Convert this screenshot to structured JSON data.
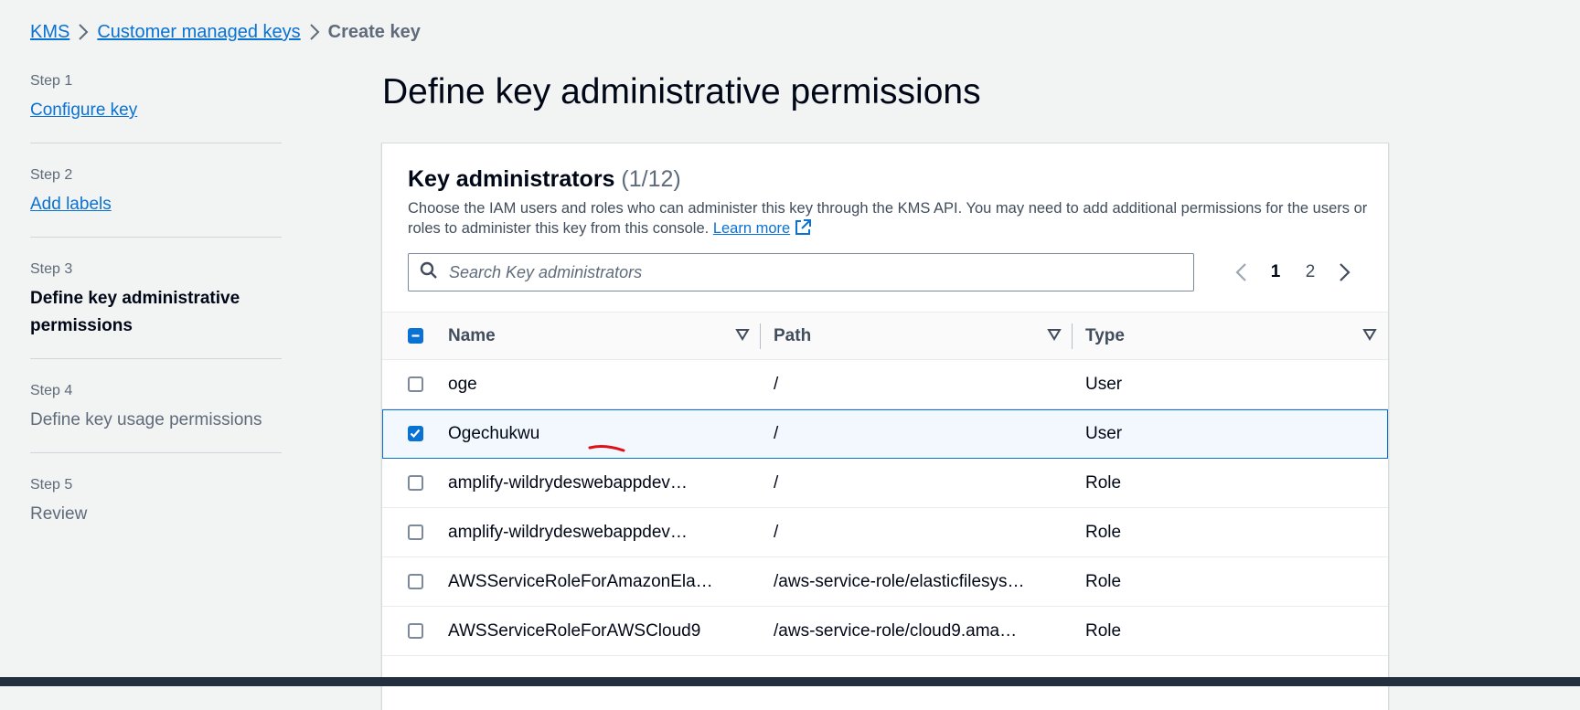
{
  "breadcrumb": {
    "items": [
      "KMS",
      "Customer managed keys"
    ],
    "current": "Create key"
  },
  "steps": [
    {
      "num": "Step 1",
      "title": "Configure key",
      "state": "link"
    },
    {
      "num": "Step 2",
      "title": "Add labels",
      "state": "link"
    },
    {
      "num": "Step 3",
      "title": "Define key administrative permissions",
      "state": "active"
    },
    {
      "num": "Step 4",
      "title": "Define key usage permissions",
      "state": "disabled"
    },
    {
      "num": "Step 5",
      "title": "Review",
      "state": "disabled"
    }
  ],
  "page": {
    "title": "Define key administrative permissions"
  },
  "panel": {
    "heading": "Key administrators",
    "count": "(1/12)",
    "description": "Choose the IAM users and roles who can administer this key through the KMS API. You may need to add additional permissions for the users or roles to administer this key from this console.",
    "learn_more": "Learn more"
  },
  "search": {
    "placeholder": "Search Key administrators",
    "value": ""
  },
  "pagination": {
    "pages": [
      "1",
      "2"
    ],
    "current_page": "1"
  },
  "table": {
    "columns": [
      "Name",
      "Path",
      "Type"
    ],
    "rows": [
      {
        "name": "oge",
        "path": "/",
        "type": "User",
        "checked": false
      },
      {
        "name": "Ogechukwu",
        "path": "/",
        "type": "User",
        "checked": true
      },
      {
        "name": "amplify-wildrydeswebappdev…",
        "path": "/",
        "type": "Role",
        "checked": false
      },
      {
        "name": "amplify-wildrydeswebappdev…",
        "path": "/",
        "type": "Role",
        "checked": false
      },
      {
        "name": "AWSServiceRoleForAmazonEla…",
        "path": "/aws-service-role/elasticfilesys…",
        "type": "Role",
        "checked": false
      },
      {
        "name": "AWSServiceRoleForAWSCloud9",
        "path": "/aws-service-role/cloud9.ama…",
        "type": "Role",
        "checked": false
      }
    ]
  },
  "colors": {
    "link": "#0972d3",
    "selected_row_bg": "#f2f8fd",
    "annotation_stroke": "#e0101a",
    "footer": "#232f3e"
  }
}
